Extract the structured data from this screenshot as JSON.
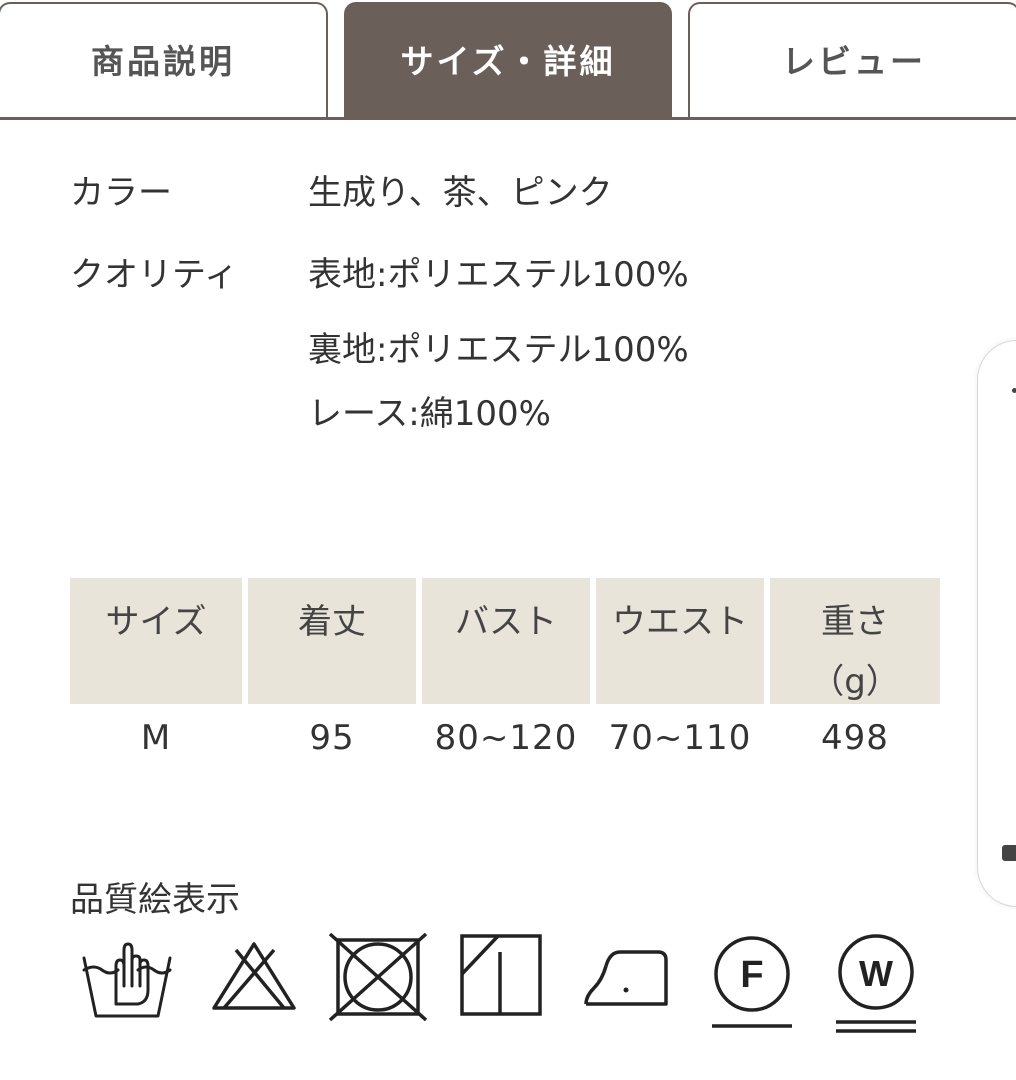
{
  "tabs": [
    {
      "label": "商品説明",
      "active": false
    },
    {
      "label": "サイズ・詳細",
      "active": true
    },
    {
      "label": "レビュー",
      "active": false
    }
  ],
  "specs": {
    "color": {
      "label": "カラー",
      "value": "生成り、茶、ピンク"
    },
    "quality": {
      "label": "クオリティ",
      "lines": [
        "表地:ポリエステル100%",
        "裏地:ポリエステル100%",
        "レース:綿100%"
      ]
    }
  },
  "size_table": {
    "headers": [
      "サイズ",
      "着丈",
      "バスト",
      "ウエスト",
      "重さ",
      "（g）"
    ],
    "row": [
      "M",
      "95",
      "80~120",
      "70~110",
      "498"
    ]
  },
  "care": {
    "title": "品質絵表示",
    "symbols": [
      "hand-wash-icon",
      "no-bleach-icon",
      "no-tumble-dry-icon",
      "line-dry-shade-icon",
      "iron-low-icon",
      "dry-clean-f-icon",
      "wet-clean-w-icon"
    ],
    "dry_clean_letter": "F",
    "wet_clean_letter": "W"
  },
  "colors": {
    "accent": "#6b5f5a",
    "table_header_bg": "#e9e4da"
  }
}
